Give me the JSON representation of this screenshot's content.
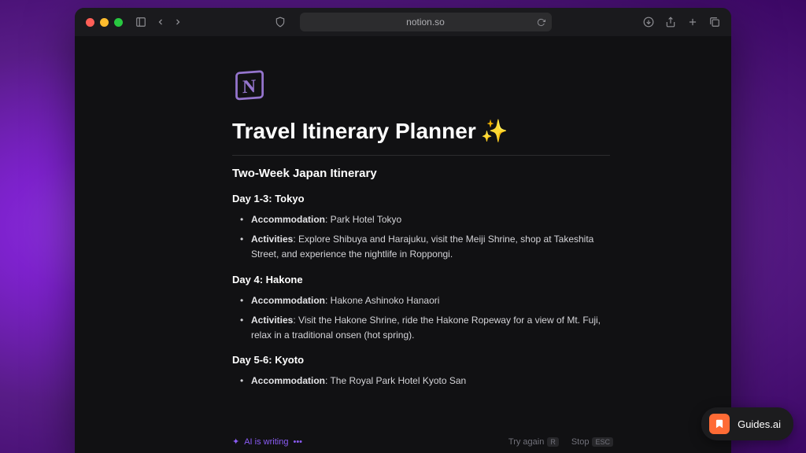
{
  "browser": {
    "url": "notion.so"
  },
  "page": {
    "title": "Travel Itinerary Planner",
    "subtitle": "Two-Week Japan Itinerary",
    "days": [
      {
        "heading": "Day 1-3: Tokyo",
        "accommodation_label": "Accommodation",
        "accommodation_value": ": Park Hotel Tokyo",
        "activities_label": "Activities",
        "activities_value": ": Explore Shibuya and Harajuku, visit the Meiji Shrine, shop at Takeshita Street, and experience the nightlife in Roppongi."
      },
      {
        "heading": "Day 4: Hakone",
        "accommodation_label": "Accommodation",
        "accommodation_value": ": Hakone Ashinoko Hanaori",
        "activities_label": "Activities",
        "activities_value": ": Visit the Hakone Shrine, ride the Hakone Ropeway for a view of Mt. Fuji, relax in a traditional onsen (hot spring)."
      },
      {
        "heading": "Day 5-6: Kyoto",
        "accommodation_label": "Accommodation",
        "accommodation_value": ": The Royal Park Hotel Kyoto San"
      }
    ]
  },
  "ai_status": {
    "writing": "AI is writing",
    "try_again": "Try again",
    "try_again_key": "R",
    "stop": "Stop",
    "stop_key": "ESC"
  },
  "guides_badge": "Guides.ai"
}
